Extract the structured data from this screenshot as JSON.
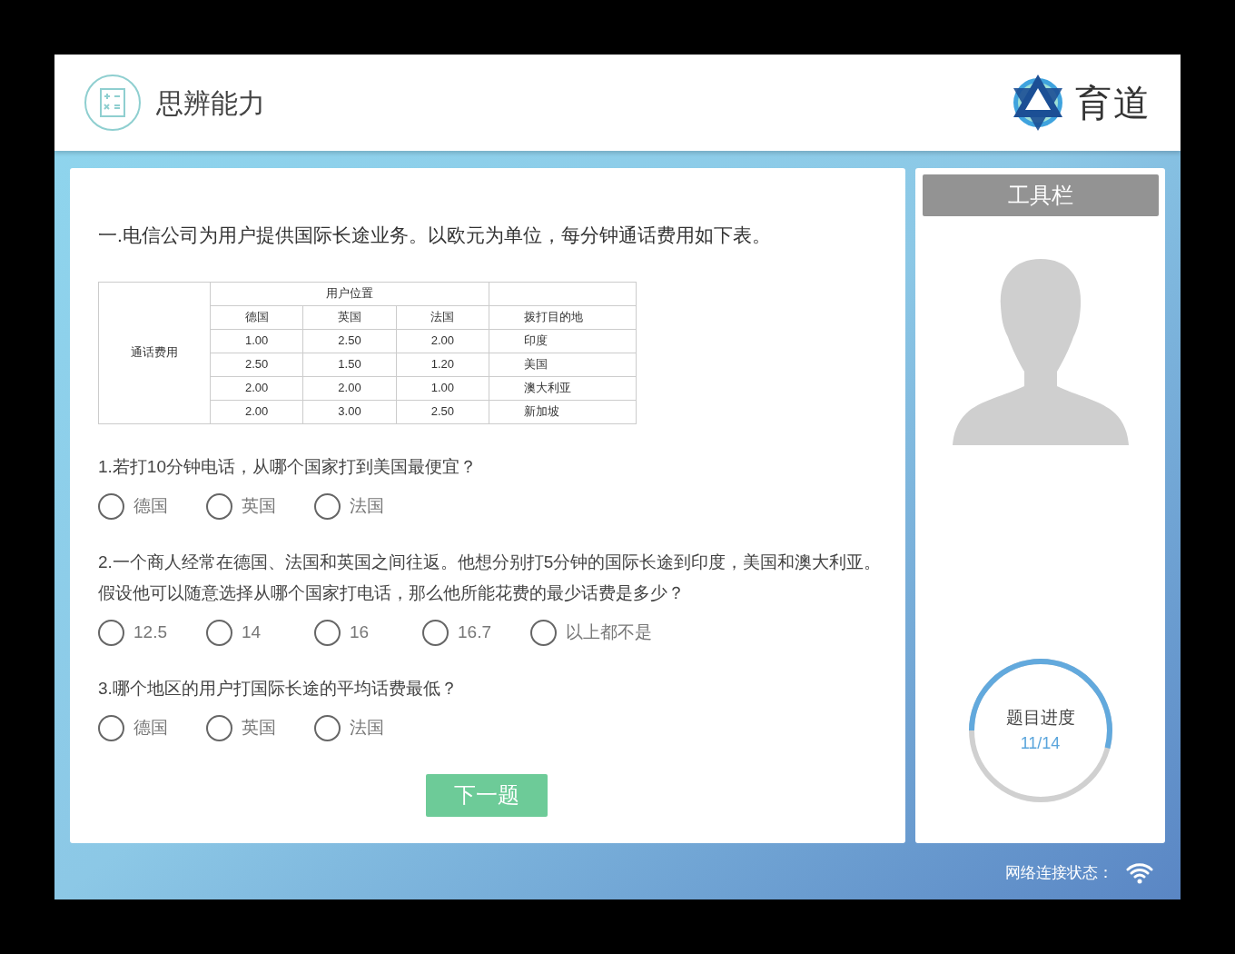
{
  "header": {
    "title": "思辨能力",
    "logo_text": "育道"
  },
  "question": {
    "title": "一.电信公司为用户提供国际长途业务。以欧元为单位，每分钟通话费用如下表。"
  },
  "table": {
    "row_header": "通话费用",
    "group_header": "用户位置",
    "columns": [
      "德国",
      "英国",
      "法国",
      "拨打目的地"
    ],
    "rows": [
      [
        "1.00",
        "2.50",
        "2.00",
        "印度"
      ],
      [
        "2.50",
        "1.50",
        "1.20",
        "美国"
      ],
      [
        "2.00",
        "2.00",
        "1.00",
        "澳大利亚"
      ],
      [
        "2.00",
        "3.00",
        "2.50",
        "新加坡"
      ]
    ]
  },
  "subquestions": [
    {
      "text": "1.若打10分钟电话，从哪个国家打到美国最便宜？",
      "options": [
        {
          "label": "德国",
          "selected": false
        },
        {
          "label": "英国",
          "selected": false
        },
        {
          "label": "法国",
          "selected": false
        }
      ]
    },
    {
      "text": "2.一个商人经常在德国、法国和英国之间往返。他想分别打5分钟的国际长途到印度，美国和澳大利亚。假设他可以随意选择从哪个国家打电话，那么他所能花费的最少话费是多少？",
      "options": [
        {
          "label": "12.5",
          "selected": false
        },
        {
          "label": "14",
          "selected": false
        },
        {
          "label": "16",
          "selected": false
        },
        {
          "label": "16.7",
          "selected": false
        },
        {
          "label": "以上都不是",
          "selected": false
        }
      ]
    },
    {
      "text": "3.哪个地区的用户打国际长途的平均话费最低？",
      "options": [
        {
          "label": "德国",
          "selected": false
        },
        {
          "label": "英国",
          "selected": false
        },
        {
          "label": "法国",
          "selected": false
        }
      ]
    }
  ],
  "next_button": "下一题",
  "toolbar": {
    "title": "工具栏"
  },
  "progress": {
    "label": "题目进度",
    "count": "11/14",
    "level": 0.54
  },
  "status_bar": {
    "label": "网络连接状态："
  }
}
